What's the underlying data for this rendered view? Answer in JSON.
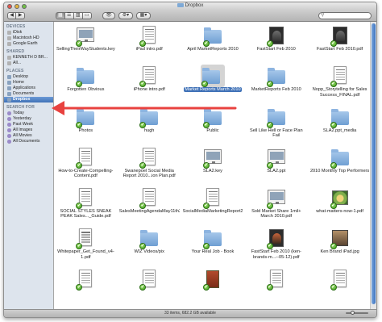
{
  "window": {
    "title": "Dropbox"
  },
  "toolbar": {
    "back": "◀",
    "forward": "▶",
    "views": [
      "▦",
      "☰",
      "▥",
      "▭"
    ],
    "quicklook": "👁",
    "action": "⚙▾",
    "arrange": "▦▾",
    "search_placeholder": ""
  },
  "sidebar": {
    "sections": [
      {
        "heading": "DEVICES",
        "items": [
          {
            "label": "iDisk",
            "icon": "drive-icon"
          },
          {
            "label": "Macintosh HD",
            "icon": "drive-icon"
          },
          {
            "label": "Google Earth",
            "icon": "drive-icon"
          }
        ]
      },
      {
        "heading": "SHARED",
        "items": [
          {
            "label": "KENNETH D BR...",
            "icon": "computer-icon"
          },
          {
            "label": "All...",
            "icon": "network-icon"
          }
        ]
      },
      {
        "heading": "PLACES",
        "items": [
          {
            "label": "Desktop",
            "icon": "folder-icon"
          },
          {
            "label": "Home",
            "icon": "home-icon"
          },
          {
            "label": "Applications",
            "icon": "folder-icon"
          },
          {
            "label": "Documents",
            "icon": "folder-icon"
          },
          {
            "label": "Dropbox",
            "icon": "folder-icon",
            "selected": true
          }
        ]
      },
      {
        "heading": "SEARCH FOR",
        "items": [
          {
            "label": "Today",
            "icon": "search-icon"
          },
          {
            "label": "Yesterday",
            "icon": "search-icon"
          },
          {
            "label": "Past Week",
            "icon": "search-icon"
          },
          {
            "label": "All Images",
            "icon": "search-icon"
          },
          {
            "label": "All Movies",
            "icon": "search-icon"
          },
          {
            "label": "All Documents",
            "icon": "search-icon"
          }
        ]
      }
    ]
  },
  "files": [
    {
      "name": "SellingTheirWayStudents.key",
      "kind": "keynote"
    },
    {
      "name": "iPad intro.pdf",
      "kind": "doc"
    },
    {
      "name": "April MarketReports 2010",
      "kind": "folder"
    },
    {
      "name": "FastStart Feb 2010",
      "kind": "dark"
    },
    {
      "name": "FastStart Feb 2010.pdf",
      "kind": "dark"
    },
    {
      "name": "Forgotten Obvious",
      "kind": "folder"
    },
    {
      "name": "iPhone intro.pdf",
      "kind": "doc"
    },
    {
      "name": "Market Reports March 2010",
      "kind": "folder",
      "selected": true
    },
    {
      "name": "MarketReports Feb 2010",
      "kind": "folder"
    },
    {
      "name": "Nopp_Storytelling for Sales Success_FINAL.pdf",
      "kind": "doc"
    },
    {
      "name": "Photos",
      "kind": "folder"
    },
    {
      "name": "hugh",
      "kind": "folder"
    },
    {
      "name": "Public",
      "kind": "folder"
    },
    {
      "name": "Sell Like Hell or Face Plan Fail",
      "kind": "folder"
    },
    {
      "name": "SLA2.ppt_media",
      "kind": "folder"
    },
    {
      "name": "How-to-Create-Compelling-Content.pdf",
      "kind": "doc"
    },
    {
      "name": "Swanepoel Social Media Report 2010...ion Plan.pdf",
      "kind": "doc"
    },
    {
      "name": "SLA2.key",
      "kind": "keynote"
    },
    {
      "name": "SLA2.ppt",
      "kind": "keynote"
    },
    {
      "name": "2010 Monthly Top Performers",
      "kind": "folder"
    },
    {
      "name": "SOCIAL STYLES SNEAK PEAK Sales..._Guide.pdf",
      "kind": "doc"
    },
    {
      "name": "SalesMeetingAgendaMay11th2010.pptx",
      "kind": "doc"
    },
    {
      "name": "SocialMediaMarketingReport2010.pdf",
      "kind": "doc"
    },
    {
      "name": "Sold Market Share 1mil+ March 2010.pdf",
      "kind": "keynote"
    },
    {
      "name": "what-matters-now-1.pdf",
      "kind": "green"
    },
    {
      "name": "Whitepaper_Get_Found_v4-1.pdf",
      "kind": "doc"
    },
    {
      "name": "WIZ Videos/pix",
      "kind": "folder"
    },
    {
      "name": "Your Real Job - Book",
      "kind": "folder"
    },
    {
      "name": "FastStart Feb 2010 (ken-brands-m...--05-12).pdf",
      "kind": "dark"
    },
    {
      "name": "Ken Brand iPad.jpg",
      "kind": "people"
    },
    {
      "name": "",
      "kind": "doc"
    },
    {
      "name": "",
      "kind": "doc"
    },
    {
      "name": "",
      "kind": "book"
    },
    {
      "name": "",
      "kind": "doc"
    },
    {
      "name": "",
      "kind": "doc"
    }
  ],
  "status": {
    "text": "33 items, 682.2 GB available"
  },
  "colors": {
    "arrow": "#e8423f",
    "selection": "#3f71b7",
    "sidebar_bg": "#dde4ed"
  }
}
